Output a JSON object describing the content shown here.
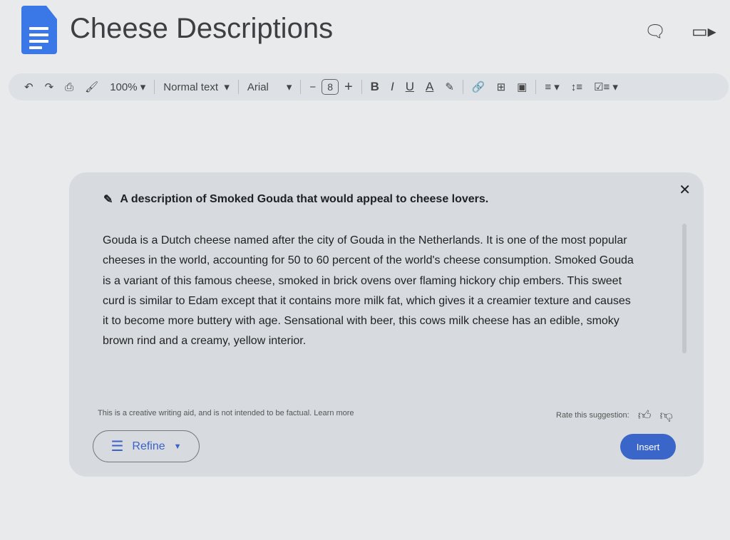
{
  "header": {
    "title": "Cheese Descriptions",
    "comment_icon": "comment-icon",
    "video_icon": "video-call-icon"
  },
  "toolbar": {
    "zoom": "100%",
    "style": "Normal text",
    "font": "Arial",
    "font_size": "8",
    "minus": "−",
    "plus": "+",
    "bold": "B",
    "italic": "I",
    "underline": "U",
    "text_color": "A"
  },
  "dialog": {
    "prompt": "A description of Smoked Gouda that would appeal to cheese lovers.",
    "text": "Gouda is a Dutch cheese named after the city of Gouda in the Netherlands. It is one of the most popular cheeses in the world, accounting for 50 to 60 percent of the world's cheese consumption. Smoked Gouda is a variant of this famous cheese, smoked in brick ovens over flaming hickory chip embers. This sweet curd is similar to Edam except that it contains more milk fat, which gives it a creamier texture and causes it to become more buttery with age. Sensational with beer, this cows milk cheese has an edible, smoky brown rind and a creamy, yellow interior.",
    "disclaimer": "This is a creative writing aid, and is not intended to be factual.",
    "learn_more": "Learn more",
    "rate_label": "Rate this suggestion:",
    "refine_label": "Refine",
    "insert_label": "Insert"
  },
  "colors": {
    "accent": "#3a66c9",
    "docs_blue": "#3b78e7"
  }
}
